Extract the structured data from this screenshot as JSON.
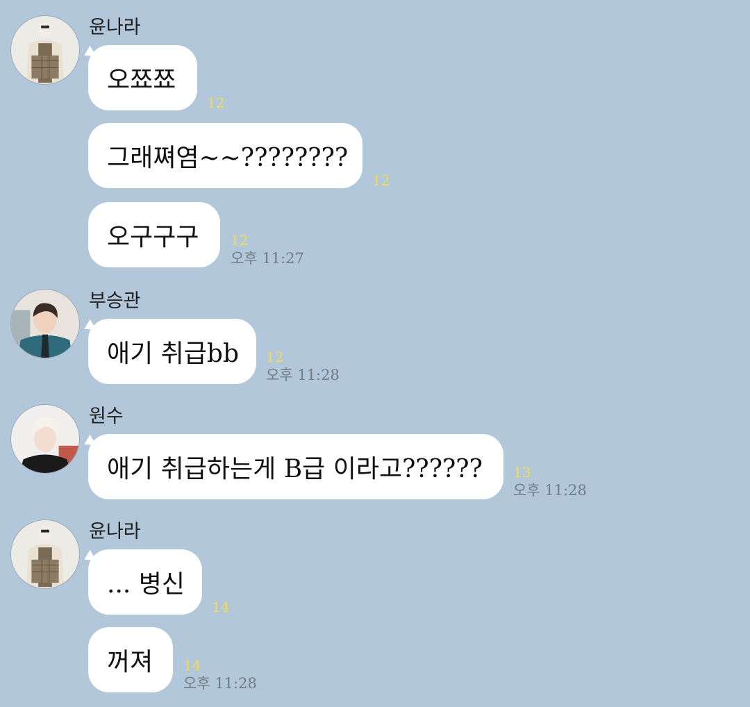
{
  "colors": {
    "background": "#b2c7da",
    "bubble": "#ffffff",
    "unread": "#f2dc4e",
    "time": "#707b86"
  },
  "groups": [
    {
      "sender": "윤나라",
      "avatar_icon": "user-photo-avatar",
      "messages": [
        {
          "text": "오쬬쬬",
          "unread": "12",
          "time": ""
        },
        {
          "text": "그래쪄염~~????????",
          "unread": "12",
          "time": ""
        },
        {
          "text": "오구구구",
          "unread": "12",
          "time": "오후 11:27"
        }
      ]
    },
    {
      "sender": "부승관",
      "avatar_icon": "user-photo-avatar",
      "messages": [
        {
          "text": "애기 취급bb",
          "unread": "12",
          "time": "오후 11:28"
        }
      ]
    },
    {
      "sender": "원수",
      "avatar_icon": "user-photo-avatar",
      "messages": [
        {
          "text": "애기 취급하는게 B급 이라고??????",
          "unread": "13",
          "time": "오후 11:28"
        }
      ]
    },
    {
      "sender": "윤나라",
      "avatar_icon": "user-photo-avatar",
      "messages": [
        {
          "text": "... 병신",
          "unread": "14",
          "time": ""
        },
        {
          "text": "꺼져",
          "unread": "14",
          "time": "오후 11:28"
        }
      ]
    }
  ]
}
